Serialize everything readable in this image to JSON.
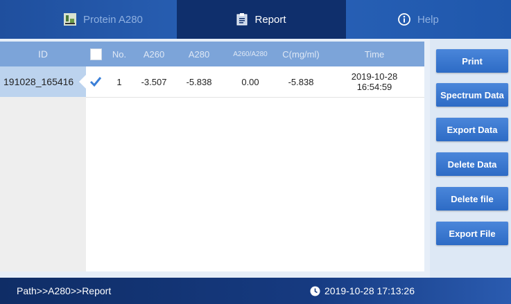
{
  "tabs": {
    "protein": "Protein A280",
    "report": "Report",
    "help": "Help"
  },
  "id_column": {
    "header": "ID",
    "items": [
      "191028_165416"
    ]
  },
  "table": {
    "headers": {
      "no": "No.",
      "a260": "A260",
      "a280": "A280",
      "ratio": "A260/A280",
      "conc": "C(mg/ml)",
      "time": "Time"
    },
    "rows": [
      {
        "checked": true,
        "no": "1",
        "a260": "-3.507",
        "a280": "-5.838",
        "ratio": "0.00",
        "conc": "-5.838",
        "time_date": "2019-10-28",
        "time_clock": "16:54:59"
      }
    ]
  },
  "buttons": {
    "print": "Print",
    "spectrum": "Spectrum Data",
    "export_data": "Export Data",
    "delete_data": "Delete Data",
    "delete_file": "Delete file",
    "export_file": "Export File"
  },
  "status": {
    "path": "Path>>A280>>Report",
    "datetime": "2019-10-28 17:13:26"
  },
  "icons": {
    "protein": "protein-icon",
    "report": "report-icon",
    "help": "info-icon",
    "clock": "clock-icon",
    "check": "checkmark-icon"
  },
  "colors": {
    "header_blue": "#7ca4d9",
    "active_tab": "#0f2f6c",
    "button_blue": "#2d6bc5",
    "selected_row": "#bcd3ee"
  }
}
